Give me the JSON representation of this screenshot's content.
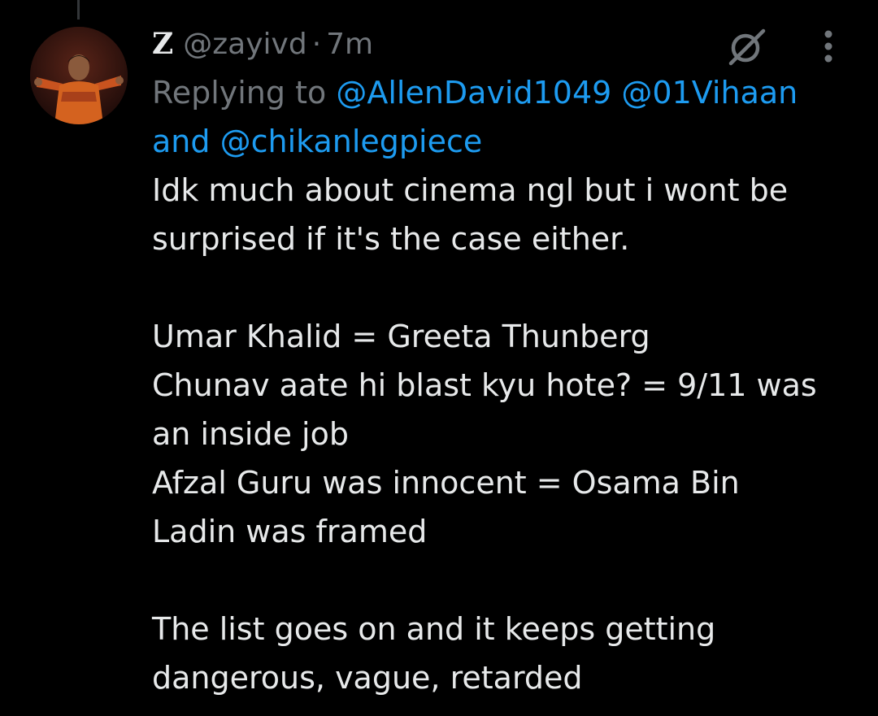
{
  "tweet": {
    "display_name": "Z",
    "handle": "@zayivd",
    "separator": "·",
    "time": "7m",
    "reply_prefix": "Replying to",
    "mentions": [
      "@AllenDavid1049",
      "@01Vihaan",
      "@chikanlegpiece"
    ],
    "reply_and": "and",
    "body_lines": [
      "Idk much about cinema ngl but i wont be",
      "surprised if it's the case either.",
      "",
      "Umar Khalid = Greeta Thunberg",
      "Chunav aate hi blast kyu hote? = 9/11 was",
      "an inside job",
      "Afzal Guru was innocent = Osama Bin",
      "Ladin was framed",
      "",
      "The list goes on and it keeps getting",
      "dangerous, vague, retarded"
    ]
  },
  "icons": {
    "grok": "grok-icon",
    "more": "more-vertical-icon"
  },
  "colors": {
    "background": "#000000",
    "primary_text": "#e7e9ea",
    "secondary_text": "#71767b",
    "link": "#1d9bf0"
  }
}
